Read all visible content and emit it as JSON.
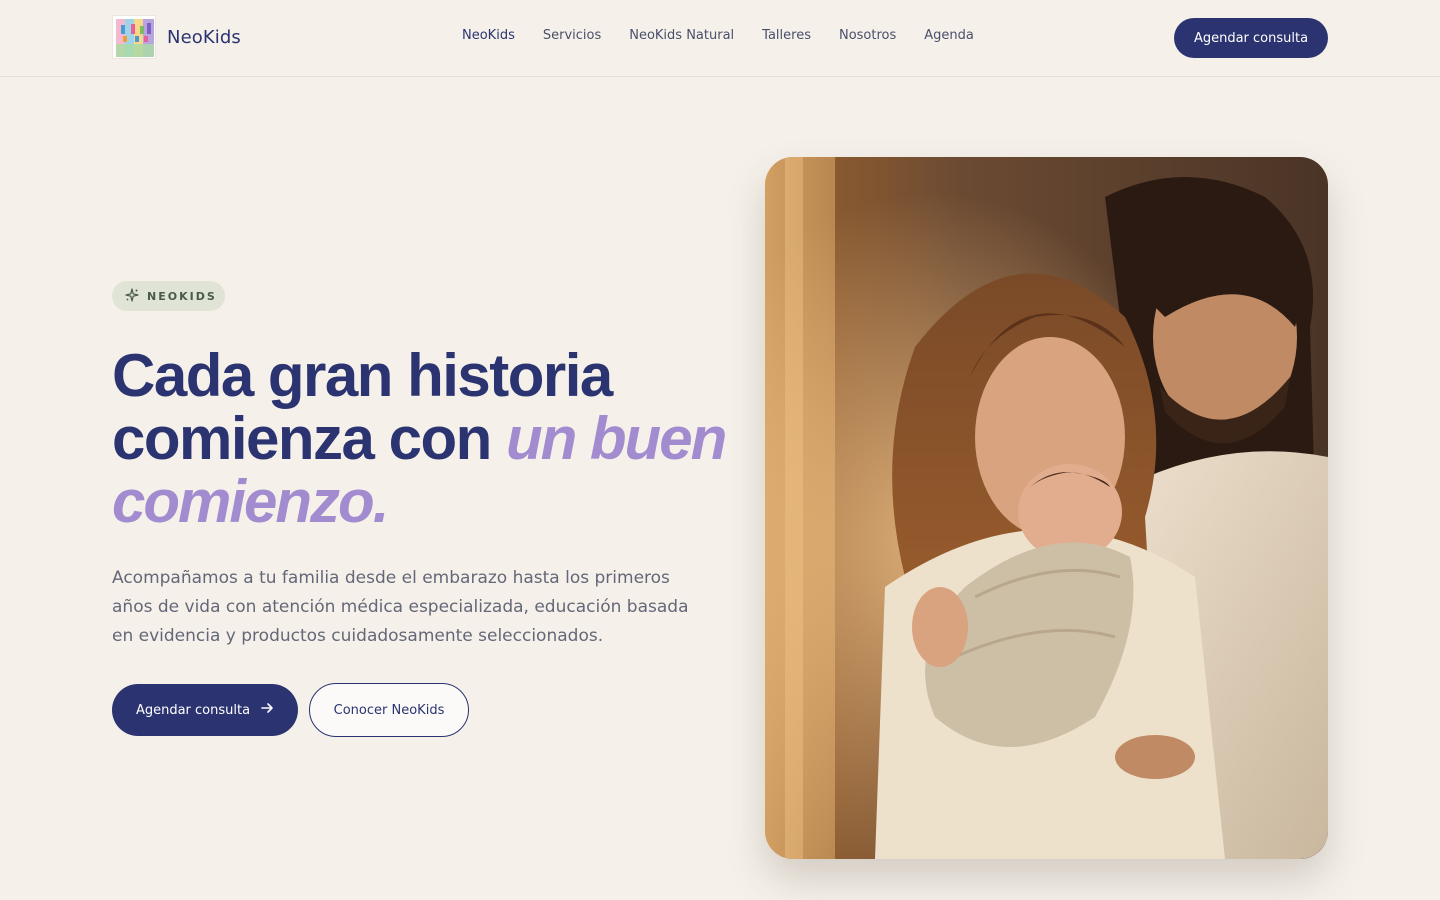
{
  "header": {
    "brand": "NeoKids",
    "logo_text": "NeoKIDS",
    "nav": [
      {
        "label": "NeoKids",
        "active": true
      },
      {
        "label": "Servicios",
        "active": false
      },
      {
        "label": "NeoKids Natural",
        "active": false
      },
      {
        "label": "Talleres",
        "active": false
      },
      {
        "label": "Nosotros",
        "active": false
      },
      {
        "label": "Agenda",
        "active": false
      }
    ],
    "cta_label": "Agendar consulta"
  },
  "hero": {
    "badge_icon": "sparkles-icon",
    "badge_label": "NEOKIDS",
    "headline_part1": "Cada gran historia comienza con ",
    "headline_accent": "un buen comienzo.",
    "description": "Acompañamos a tu familia desde el embarazo hasta los primeros años de vida con atención médica especializada, educación basada en evidencia y productos cuidadosamente seleccionados.",
    "primary_button": "Agendar consulta",
    "primary_button_icon": "arrow-right-icon",
    "secondary_button": "Conocer NeoKids",
    "image_alt": "family-holding-newborn-photo"
  },
  "colors": {
    "background": "#f5f1ea",
    "navy": "#2b3470",
    "lavender_accent": "#a28ccf",
    "badge_bg": "#dfe4d6"
  }
}
